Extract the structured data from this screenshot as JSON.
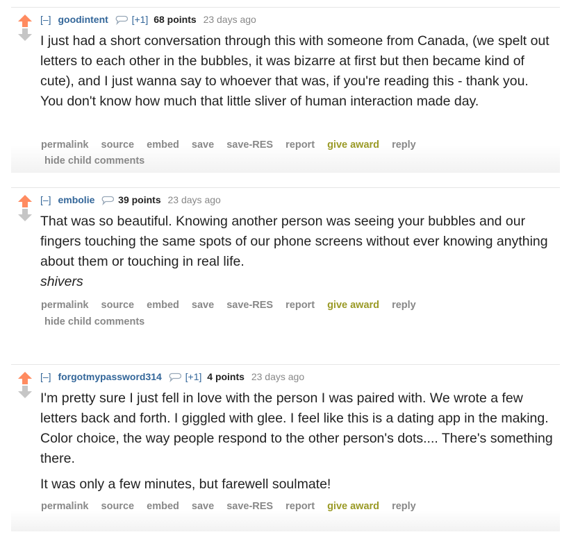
{
  "comments": [
    {
      "expand": "[–]",
      "author": "goodintent",
      "plus": "[+1]",
      "score": "68 points",
      "time": "23 days ago",
      "text": "I just had a short conversation through this with someone from Canada, (we spelt out letters to each other in the bubbles, it was bizarre at first but then became kind of cute), and I just wanna say to whoever that was, if you're reading this - thank you. You don't know how much that little sliver of human interaction made day.",
      "hide_child": "hide child comments"
    },
    {
      "expand": "[–]",
      "author": "embolie",
      "score": "39 points",
      "time": "23 days ago",
      "text": "That was so beautiful. Knowing another person was seeing your bubbles and our fingers touching the same spots of our phone screens without ever knowing anything about them or touching in real life.",
      "emphasis": "shivers",
      "hide_child": "hide child comments"
    },
    {
      "expand": "[–]",
      "author": "forgotmypassword314",
      "plus": "[+1]",
      "score": "4 points",
      "time": "23 days ago",
      "text": "I'm pretty sure I just fell in love with the person I was paired with. We wrote a few letters back and forth. I giggled with glee. I feel like this is a dating app in the making. Color choice, the way people respond to the other person's dots.... There's something there.",
      "text2": "It was only a few minutes, but farewell soulmate!"
    }
  ],
  "actions": {
    "permalink": "permalink",
    "source": "source",
    "embed": "embed",
    "save": "save",
    "save_res": "save-RES",
    "report": "report",
    "give_award": "give award",
    "reply": "reply"
  },
  "icons": {
    "upvote": "upvote-arrow-icon",
    "downvote": "downvote-arrow-icon",
    "speech_bubble": "speech-bubble-icon"
  },
  "colors": {
    "upvote": "#ff8b60",
    "downvote": "#c6c6c6",
    "author_link": "#336699",
    "award": "#9a9a26"
  }
}
